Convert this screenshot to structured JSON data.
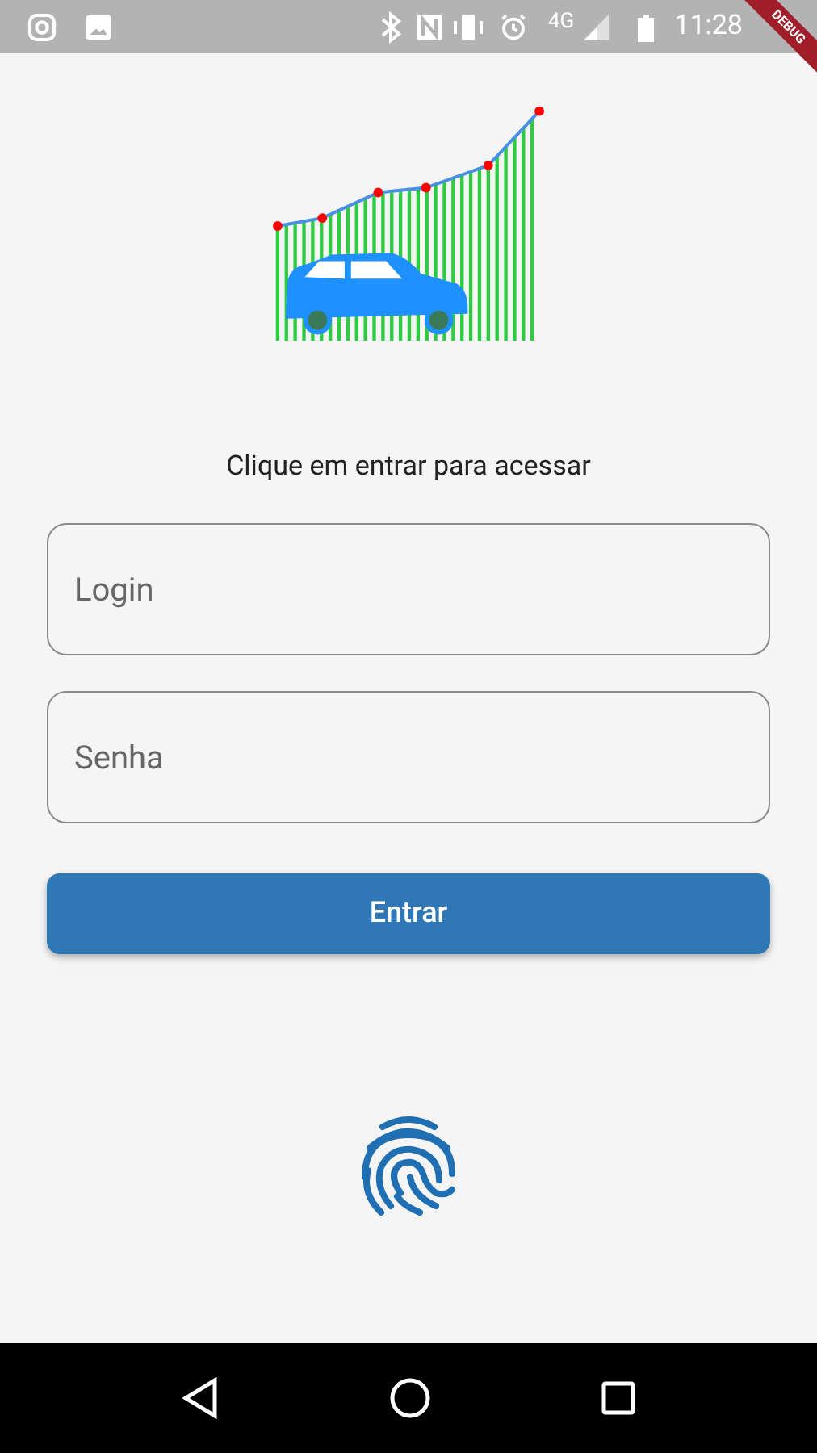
{
  "status_bar": {
    "network": "4G",
    "time": "11:28"
  },
  "debug_banner": "DEBUG",
  "prompt": "Clique em entrar para acessar",
  "fields": [
    {
      "placeholder": "Login"
    },
    {
      "placeholder": "Senha"
    }
  ],
  "submit_button": "Entrar"
}
